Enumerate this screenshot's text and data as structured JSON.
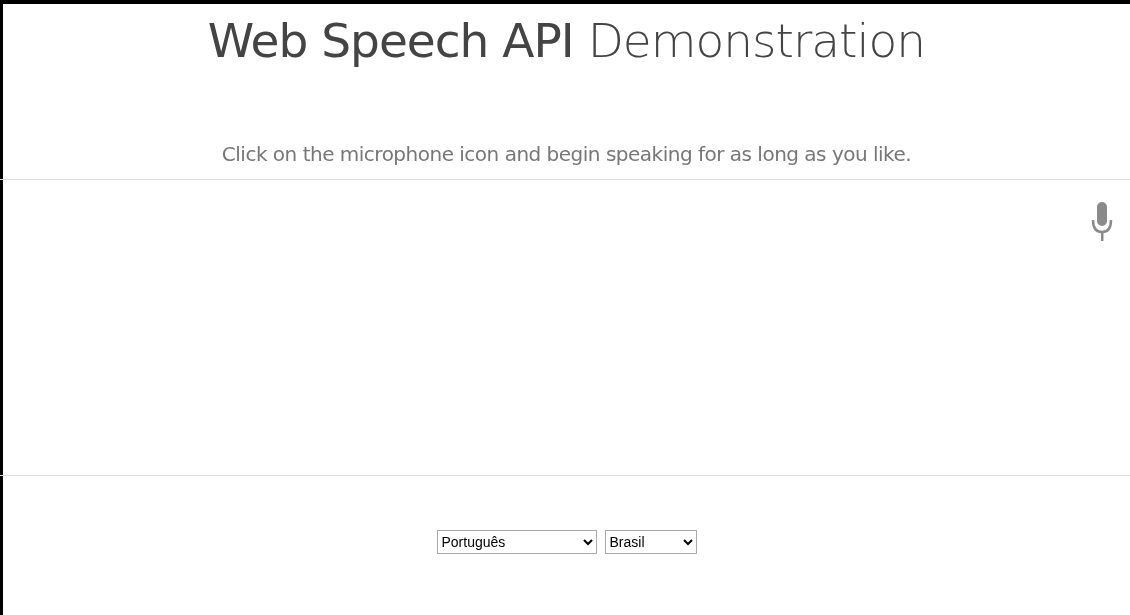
{
  "title": "**Web Speech API** Demonstration",
  "info": "Click on the microphone icon and begin speaking for as long as you like.",
  "transcript": {
    "recording": false
  },
  "selects": [
    {
      "value": "Português"
    },
    {
      "value": "Brasil"
    }
  ]
}
